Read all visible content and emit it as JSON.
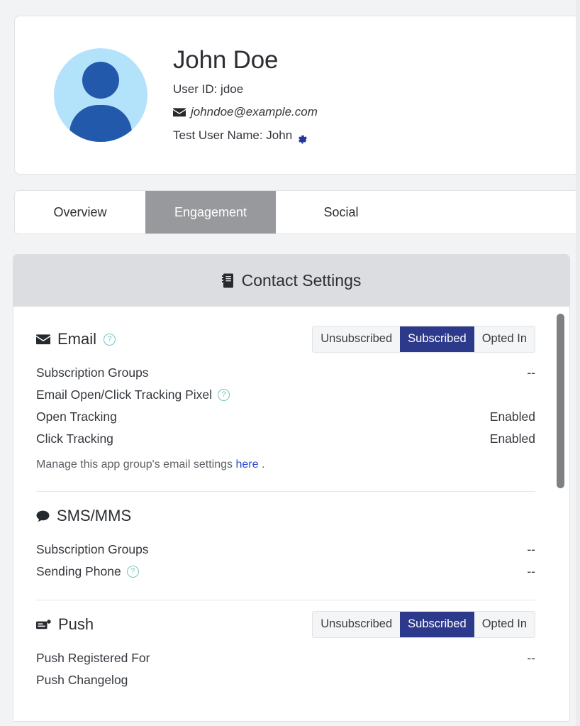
{
  "profile": {
    "name": "John Doe",
    "user_id_label": "User ID: jdoe",
    "email": "johndoe@example.com",
    "test_user_name": "Test User Name: John",
    "avatar_icon": "user-avatar-icon",
    "email_icon": "envelope-icon",
    "gear_icon": "gear-icon",
    "avatar_bg_color": "#b3e2fb",
    "avatar_fg_color": "#2259ab"
  },
  "tabs": [
    {
      "label": "Overview",
      "active": false
    },
    {
      "label": "Engagement",
      "active": true
    },
    {
      "label": "Social",
      "active": false
    }
  ],
  "contact_settings": {
    "header_title": "Contact Settings",
    "header_icon": "address-book-icon",
    "accent_active_color": "#2d3a8c",
    "help_icon_color": "#76c2bf",
    "link_color": "#2b4ad1",
    "sections": [
      {
        "id": "email",
        "title": "Email",
        "icon": "envelope-icon",
        "has_help": true,
        "help_glyph": "?",
        "segmented": {
          "options": [
            "Unsubscribed",
            "Subscribed",
            "Opted In"
          ],
          "selected": "Subscribed"
        },
        "rows": [
          {
            "label": "Subscription Groups",
            "value": "--",
            "help": false
          },
          {
            "label": "Email Open/Click Tracking Pixel",
            "value": "",
            "help": true
          },
          {
            "label": "Open Tracking",
            "value": "Enabled",
            "help": false
          },
          {
            "label": "Click Tracking",
            "value": "Enabled",
            "help": false
          }
        ],
        "note_prefix": "Manage this app group's email settings",
        "note_link": "here",
        "note_suffix": "."
      },
      {
        "id": "sms-mms",
        "title": "SMS/MMS",
        "icon": "speech-bubble-icon",
        "has_help": false,
        "segmented": null,
        "rows": [
          {
            "label": "Subscription Groups",
            "value": "--",
            "help": false
          },
          {
            "label": "Sending Phone",
            "value": "--",
            "help": true
          }
        ]
      },
      {
        "id": "push",
        "title": "Push",
        "icon": "push-notification-icon",
        "has_help": false,
        "segmented": {
          "options": [
            "Unsubscribed",
            "Subscribed",
            "Opted In"
          ],
          "selected": "Subscribed"
        },
        "rows": [
          {
            "label": "Push Registered For",
            "value": "--",
            "help": false
          },
          {
            "label": "Push Changelog",
            "value": "",
            "help": false
          }
        ]
      }
    ]
  },
  "scrollbar": {
    "name": "vertical-scrollbar"
  }
}
